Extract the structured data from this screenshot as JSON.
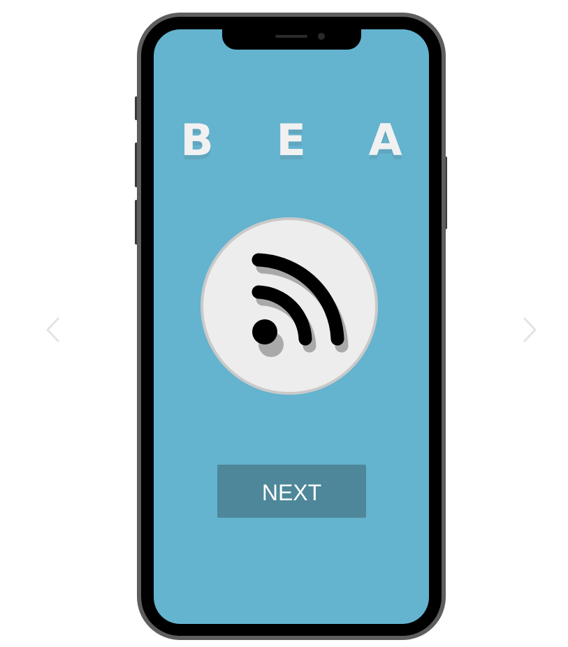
{
  "app": {
    "title": "B E A"
  },
  "onboarding": {
    "next_label": "NEXT",
    "logo_icon": "rss-feed-icon"
  },
  "carousel": {
    "prev_icon": "chevron-left-icon",
    "next_icon": "chevron-right-icon"
  },
  "colors": {
    "screen_background": "#64b3cf",
    "button_background": "#4e8799",
    "logo_circle": "#ededed",
    "title_text": "#f1f1f1"
  }
}
